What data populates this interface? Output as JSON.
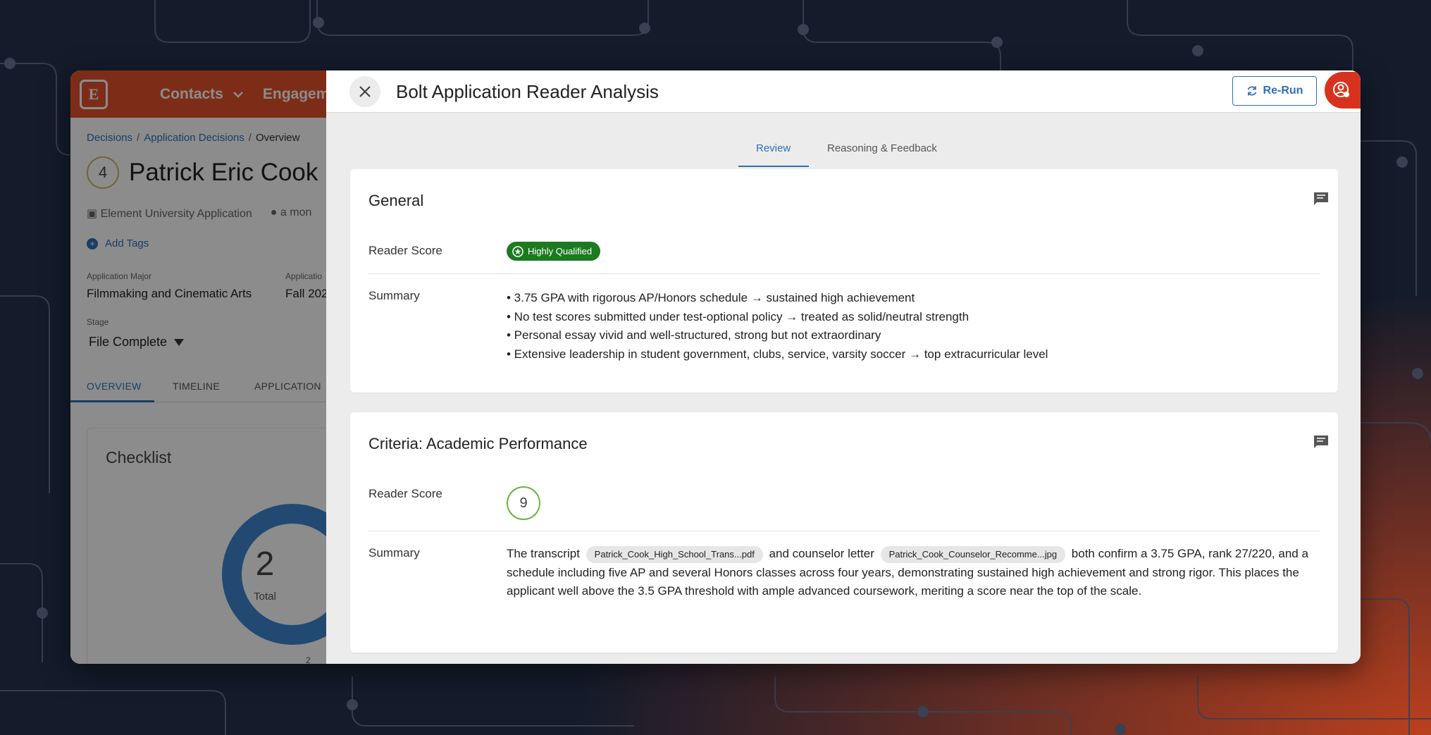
{
  "background": {
    "app": {
      "nav": {
        "contacts": "Contacts",
        "engagement": "Engageme"
      },
      "breadcrumb": [
        "Decisions",
        "Application Decisions",
        "Overview"
      ],
      "record": {
        "score": "4",
        "name": "Patrick Eric Cook",
        "application_type": "Element University Application",
        "time_ago": "a mon",
        "add_tags": "Add Tags"
      },
      "fields": {
        "major_label": "Application Major",
        "major_value": "Filmmaking and Cinematic Arts",
        "term_label": "Applicatio",
        "term_value": "Fall 202",
        "stage_label": "Stage",
        "stage_value": "File Complete"
      },
      "tabs": [
        "OVERVIEW",
        "TIMELINE",
        "APPLICATION"
      ],
      "checklist": {
        "title": "Checklist",
        "total_value": "2",
        "total_label": "Total",
        "segment_label": "2"
      }
    }
  },
  "drawer": {
    "title": "Bolt Application Reader Analysis",
    "rerun_label": "Re-Run",
    "tabs": [
      "Review",
      "Reasoning & Feedback"
    ],
    "active_tab": "Review",
    "general": {
      "title": "General",
      "reader_score_label": "Reader Score",
      "reader_score_badge": "Highly Qualified",
      "summary_label": "Summary",
      "summary_bullets": [
        "• 3.75 GPA with rigorous AP/Honors schedule → sustained high achievement",
        "• No test scores submitted under test-optional policy → treated as solid/neutral strength",
        "• Personal essay vivid and well-structured, strong but not extraordinary",
        "• Extensive leadership in student government, clubs, service, varsity soccer → top extracurricular level"
      ]
    },
    "academic": {
      "title": "Criteria: Academic Performance",
      "reader_score_label": "Reader Score",
      "reader_score_value": "9",
      "summary_label": "Summary",
      "summary_parts": {
        "p1": "The transcript",
        "chip1": "Patrick_Cook_High_School_Trans...pdf",
        "p2": "and counselor letter",
        "chip2": "Patrick_Cook_Counselor_Recomme...jpg",
        "p3": "both confirm a 3.75 GPA, rank 27/220, and a schedule including five AP and several Honors classes across four years, demonstrating sustained high achievement and strong rigor. This places the applicant well above the 3.5 GPA threshold with ample advanced coursework, meriting a score near the top of the scale."
      }
    }
  },
  "colors": {
    "brand_orange": "#e4532b",
    "link_blue": "#2f6fb8",
    "qualified_green": "#1c7a21",
    "score_ring_green": "#6cb33f",
    "user_red": "#d8321f",
    "backdrop": "#141b2b"
  },
  "icons": [
    "close-icon",
    "refresh-icon",
    "user-settings-icon",
    "comment-icon",
    "star-badge-icon",
    "chevron-down-icon",
    "caret-down-icon",
    "plus-icon"
  ]
}
